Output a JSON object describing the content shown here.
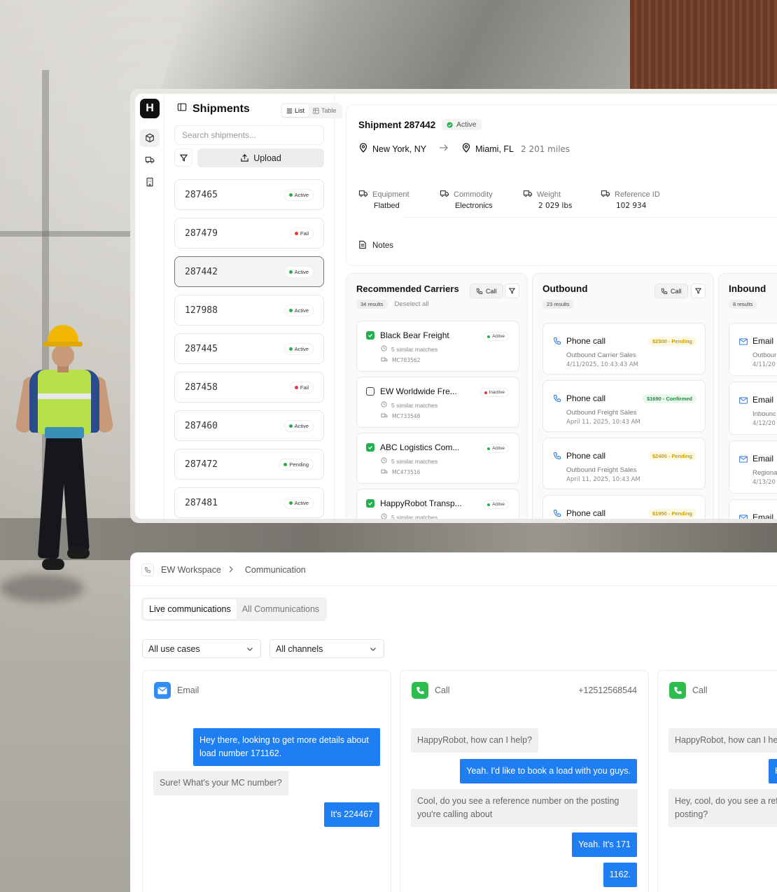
{
  "shipments_panel": {
    "title": "Shipments",
    "view_list": "List",
    "view_table": "Table",
    "search_placeholder": "Search shipments...",
    "upload_label": "Upload",
    "items": [
      {
        "id": "287465",
        "status": "Active"
      },
      {
        "id": "287479",
        "status": "Fail"
      },
      {
        "id": "287442",
        "status": "Active"
      },
      {
        "id": "127988",
        "status": "Active"
      },
      {
        "id": "287445",
        "status": "Active"
      },
      {
        "id": "287458",
        "status": "Fail"
      },
      {
        "id": "287460",
        "status": "Active"
      },
      {
        "id": "287472",
        "status": "Pending"
      },
      {
        "id": "287481",
        "status": "Active"
      }
    ]
  },
  "detail": {
    "title": "Shipment 287442",
    "status": "Active",
    "origin": "New York, NY",
    "destination": "Miami, FL",
    "distance": "2 201 miles",
    "attributes": [
      {
        "label": "Equipment",
        "value": "Flatbed"
      },
      {
        "label": "Commodity",
        "value": "Electronics"
      },
      {
        "label": "Weight",
        "value": "2 029 lbs"
      },
      {
        "label": "Reference ID",
        "value": "102 934"
      }
    ],
    "notes_label": "Notes"
  },
  "carriers": {
    "title": "Recommended Carriers",
    "call_label": "Call",
    "results": "34 results",
    "deselect": "Deselect all",
    "items": [
      {
        "name": "Black Bear Freight",
        "checked": true,
        "status": "Active",
        "matches": "5 similar matches",
        "mc": "MC783562"
      },
      {
        "name": "EW Worldwide Fre...",
        "checked": false,
        "status": "Inactive",
        "matches": "5 similar matches",
        "mc": "MC733548"
      },
      {
        "name": "ABC Logistics Com...",
        "checked": true,
        "status": "Active",
        "matches": "5 similar matches",
        "mc": "MC473516"
      },
      {
        "name": "HappyRobot Transp...",
        "checked": true,
        "status": "Active",
        "matches": "5 similar matches"
      }
    ]
  },
  "outbound": {
    "title": "Outbound",
    "call_label": "Call",
    "results": "23 results",
    "items": [
      {
        "title": "Phone call",
        "amount": "$2500 - Pending",
        "kind": "pending",
        "line2": "Outbound Carrier Sales",
        "line3": "4/11/2025, 10:43:43 AM"
      },
      {
        "title": "Phone call",
        "amount": "$1690 - Confirmed",
        "kind": "confirmed",
        "line2": "Outbound Freight Sales",
        "line3": "April 11, 2025, 10:43 AM"
      },
      {
        "title": "Phone call",
        "amount": "$2400 - Pending",
        "kind": "pending",
        "line2": "Outbound Freight Sales",
        "line3": "April 11, 2025, 10:43 AM"
      },
      {
        "title": "Phone call",
        "amount": "$1950 - Pending",
        "kind": "pending"
      }
    ]
  },
  "inbound": {
    "title": "Inbound",
    "results": "8 results",
    "items": [
      {
        "title": "Email",
        "line2": "Outbour",
        "line3": "4/11/20"
      },
      {
        "title": "Email",
        "line2": "Inbounc",
        "line3": "4/12/20"
      },
      {
        "title": "Email",
        "line2": "Regiona",
        "line3": "4/13/20"
      },
      {
        "title": "Email"
      }
    ]
  },
  "comms": {
    "breadcrumb_workspace": "EW Workspace",
    "breadcrumb_page": "Communication",
    "tab_live": "Live communications",
    "tab_all": "All Communications",
    "filter_use_cases": "All use cases",
    "filter_channels": "All channels",
    "conversations": [
      {
        "channel": "Email",
        "messages": [
          {
            "from": "user",
            "text": "Hey there, looking to get more details about load number 171162."
          },
          {
            "from": "agent",
            "text": "Sure! What's your MC number?"
          },
          {
            "from": "user",
            "text": "It's 224467"
          }
        ]
      },
      {
        "channel": "Call",
        "number": "+12512568544",
        "messages": [
          {
            "from": "agent",
            "text": "HappyRobot, how can I help?"
          },
          {
            "from": "user",
            "text": "Yeah. I'd like to book a load with you guys."
          },
          {
            "from": "agent",
            "text": "Cool, do you see a reference number on the posting you're calling about"
          },
          {
            "from": "user",
            "text": "Yeah. It's 171"
          },
          {
            "from": "user",
            "text": "1162."
          }
        ]
      },
      {
        "channel": "Call",
        "messages": [
          {
            "from": "agent",
            "text": "HappyRobot, how can I he"
          },
          {
            "from": "user",
            "text": "H"
          },
          {
            "from": "agent",
            "text": "Hey, cool, do you see a ref posting?"
          }
        ]
      }
    ]
  },
  "colors": {
    "active": "#22b14c",
    "fail": "#e53935",
    "pending_text": "#c9a000",
    "confirmed_text": "#1e8e3e",
    "bubble_blue": "#1f7ff2",
    "email_blue": "#2f8df5",
    "call_green": "#2dbd4e"
  }
}
